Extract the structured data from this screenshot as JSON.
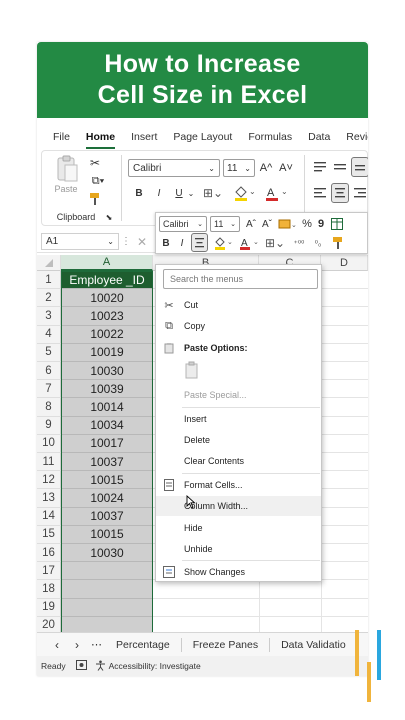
{
  "banner": {
    "line1": "How to Increase",
    "line2": "Cell Size in Excel"
  },
  "tabs": [
    "File",
    "Home",
    "Insert",
    "Page Layout",
    "Formulas",
    "Data",
    "Review"
  ],
  "active_tab": "Home",
  "ribbon": {
    "paste_label": "Paste",
    "clipboard_label": "Clipboard",
    "font_name": "Calibri",
    "font_size": "11",
    "grow_font": "A^",
    "shrink_font": "A˅",
    "bold": "B",
    "italic": "I",
    "underline": "U"
  },
  "mini_toolbar": {
    "font_name": "Calibri",
    "font_size": "11",
    "percent": "%",
    "comma": "9",
    "bold": "B",
    "italic": "I"
  },
  "formula_bar": {
    "name_box": "A1"
  },
  "columns": [
    "A",
    "B",
    "C",
    "D"
  ],
  "rows": [
    "1",
    "2",
    "3",
    "4",
    "5",
    "6",
    "7",
    "8",
    "9",
    "10",
    "11",
    "12",
    "13",
    "14",
    "15",
    "16",
    "17",
    "18",
    "19",
    "20"
  ],
  "column_a": [
    "Employee _ID",
    "10020",
    "10023",
    "10022",
    "10019",
    "10030",
    "10039",
    "10014",
    "10034",
    "10017",
    "10037",
    "10015",
    "10024",
    "10037",
    "10015",
    "10030",
    "",
    "",
    "",
    ""
  ],
  "context_menu": {
    "search_placeholder": "Search the menus",
    "cut": "Cut",
    "copy": "Copy",
    "paste_options": "Paste Options:",
    "paste_special": "Paste Special...",
    "insert": "Insert",
    "delete": "Delete",
    "clear_contents": "Clear Contents",
    "format_cells": "Format Cells...",
    "column_width": "Column Width...",
    "hide": "Hide",
    "unhide": "Unhide",
    "show_changes": "Show Changes"
  },
  "sheet_tabs": [
    "Percentage",
    "Freeze Panes",
    "Data Validatio"
  ],
  "status": {
    "ready": "Ready",
    "accessibility": "Accessibility: Investigate"
  },
  "colors": {
    "banner": "#238a44",
    "header_cell": "#1e5e2f",
    "selection": "#cfcfcf"
  }
}
